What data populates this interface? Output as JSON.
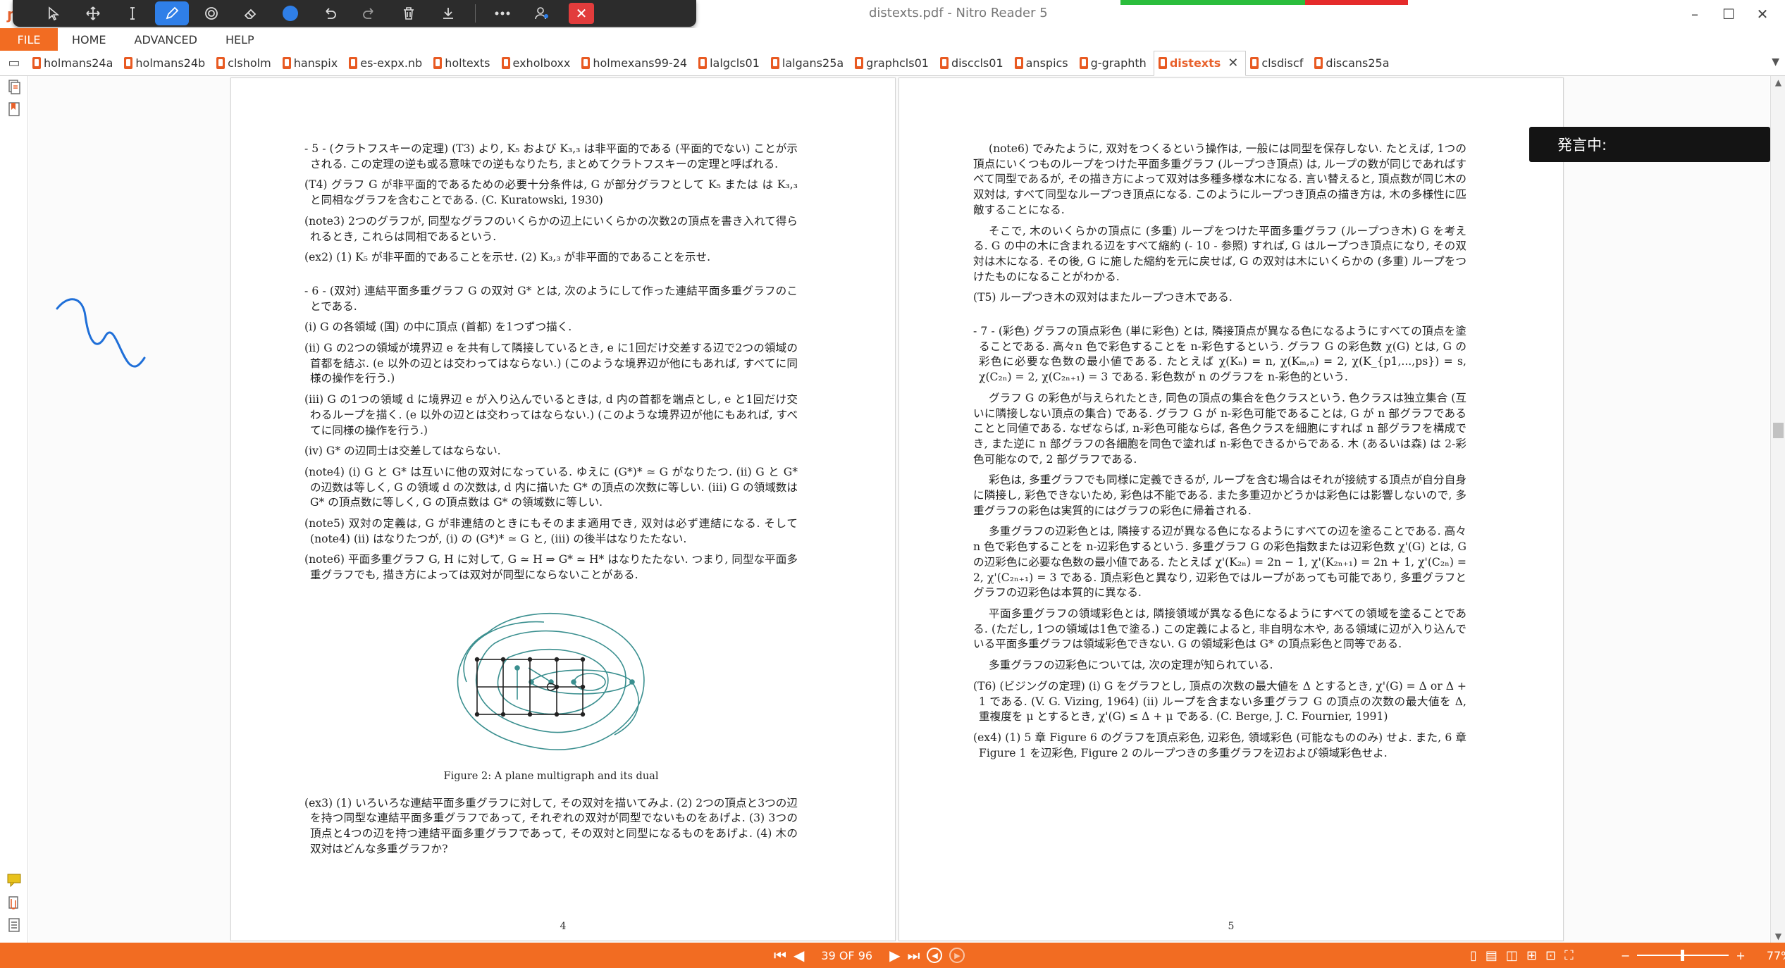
{
  "app": {
    "title": "distexts.pdf - Nitro Reader 5"
  },
  "window": {
    "minimize": "–",
    "maximize": "☐",
    "close": "✕"
  },
  "toolbar": {
    "tools": [
      "select-arrow-icon",
      "pan-icon",
      "text-cursor-icon",
      "pen-icon",
      "stamp-icon",
      "eraser-icon",
      "color-icon",
      "undo-icon",
      "redo-icon",
      "delete-icon",
      "download-icon",
      "more-icon",
      "share-icon",
      "close-icon"
    ],
    "active_tool": "pen-icon",
    "close_label": "✕"
  },
  "menu": {
    "file": "FILE",
    "items": [
      "HOME",
      "ADVANCED",
      "HELP"
    ]
  },
  "tabs": [
    {
      "label": "holmans24a"
    },
    {
      "label": "holmans24b"
    },
    {
      "label": "clsholm"
    },
    {
      "label": "hanspix"
    },
    {
      "label": "es-expx.nb"
    },
    {
      "label": "holtexts"
    },
    {
      "label": "exholboxx"
    },
    {
      "label": "holmexans99-24"
    },
    {
      "label": "lalgcls01"
    },
    {
      "label": "lalgans25a"
    },
    {
      "label": "graphcls01"
    },
    {
      "label": "disccls01"
    },
    {
      "label": "anspics"
    },
    {
      "label": "g-graphth"
    },
    {
      "label": "distexts",
      "active": true
    },
    {
      "label": "clsdiscf"
    },
    {
      "label": "discans25a"
    }
  ],
  "tab_close": "✕",
  "overlay": {
    "speaking_label": "発言中:"
  },
  "pages": {
    "left": {
      "number": "4",
      "paragraphs": [
        "- 5 - (クラトフスキーの定理) (T3) より, K₅ および K₃,₃ は非平面的である (平面的でない) ことが示される. この定理の逆も或る意味での逆もなりたち, まとめてクラトフスキーの定理と呼ばれる.",
        "(T4) グラフ G が非平面的であるための必要十分条件は, G が部分グラフとして K₅ または は K₃,₃ と同相なグラフを含むことである. (C. Kuratowski, 1930)",
        "(note3) 2つのグラフが, 同型なグラフのいくらかの辺上にいくらかの次数2の頂点を書き入れて得られるとき, これらは同相であるという.",
        "(ex2) (1) K₅ が非平面的であることを示せ. (2) K₃,₃ が非平面的であることを示せ.",
        "- 6 - (双対) 連結平面多重グラフ G の双対 G* とは, 次のようにして作った連結平面多重グラフのことである.",
        "(i) G の各領域 (国) の中に頂点 (首都) を1つずつ描く.",
        "(ii) G の2つの領域が境界辺 e を共有して隣接しているとき, e に1回だけ交差する辺で2つの領域の首都を結ぶ. (e 以外の辺とは交わってはならない.) (このような境界辺が他にもあれば, すべてに同様の操作を行う.)",
        "(iii) G の1つの領域 d に境界辺 e が入り込んでいるときは, d 内の首都を端点とし, e と1回だけ交わるループを描く. (e 以外の辺とは交わってはならない.) (このような境界辺が他にもあれば, すべてに同様の操作を行う.)",
        "(iv) G* の辺同士は交差してはならない.",
        "(note4) (i) G と G* は互いに他の双対になっている. ゆえに (G*)* ≃ G がなりたつ. (ii) G と G* の辺数は等しく, G の領域 d の次数は, d 内に描いた G* の頂点の次数に等しい. (iii) G の領域数は G* の頂点数に等しく, G の頂点数は G* の領域数に等しい.",
        "(note5) 双対の定義は, G が非連結のときにもそのまま適用でき, 双対は必ず連結になる. そして (note4) (ii) はなりたつが, (i) の (G*)* ≃ G と, (iii) の後半はなりたたない.",
        "(note6) 平面多重グラフ G, H に対して, G ≃ H ⇒ G* ≃ H* はなりたたない. つまり, 同型な平面多重グラフでも, 描き方によっては双対が同型にならないことがある."
      ],
      "figure_caption": "Figure 2: A plane multigraph and its dual",
      "after_figure": "(ex3) (1) いろいろな連結平面多重グラフに対して, その双対を描いてみよ. (2) 2つの頂点と3つの辺を持つ同型な連結平面多重グラフであって, それぞれの双対が同型でないものをあげよ. (3) 3つの頂点と4つの辺を持つ連結平面多重グラフであって, その双対と同型になるものをあげよ. (4) 木の双対はどんな多重グラフか?"
    },
    "right": {
      "number": "5",
      "paragraphs": [
        "(note6) でみたように, 双対をつくるという操作は, 一般には同型を保存しない. たとえば, 1つの頂点にいくつものループをつけた平面多重グラフ (ループつき頂点) は, ループの数が同じであればすべて同型であるが, その描き方によって双対は多種多様な木になる. 言い替えると, 頂点数が同じ木の双対は, すべて同型なループつき頂点になる. このようにループつき頂点の描き方は, 木の多様性に匹敵することになる.",
        "そこで, 木のいくらかの頂点に (多重) ループをつけた平面多重グラフ (ループつき木) G を考える. G の中の木に含まれる辺をすべて縮約 (- 10 - 参照) すれば, G はループつき頂点になり, その双対は木になる. その後, G に施した縮約を元に戻せば, G の双対は木にいくらかの (多重) ループをつけたものになることがわかる.",
        "(T5) ループつき木の双対はまたループつき木である.",
        "- 7 - (彩色) グラフの頂点彩色 (単に彩色) とは, 隣接頂点が異なる色になるようにすべての頂点を塗ることである. 高々n 色で彩色することを n-彩色するという. グラフ G の彩色数 χ(G) とは, G の彩色に必要な色数の最小値である. たとえば χ(Kₙ) = n, χ(Kₘ,ₙ) = 2, χ(K_{p1,...,ps}) = s, χ(C₂ₙ) = 2, χ(C₂ₙ₊₁) = 3 である. 彩色数が n のグラフを n-彩色的という.",
        "グラフ G の彩色が与えられたとき, 同色の頂点の集合を色クラスという. 色クラスは独立集合 (互いに隣接しない頂点の集合) である. グラフ G が n-彩色可能であることは, G が n 部グラフであることと同値である. なぜならば, n-彩色可能ならば, 各色クラスを細胞にすれば n 部グラフを構成でき, また逆に n 部グラフの各細胞を同色で塗れば n-彩色できるからである. 木 (あるいは森) は 2-彩色可能なので, 2 部グラフである.",
        "彩色は, 多重グラフでも同様に定義できるが, ループを含む場合はそれが接続する頂点が自分自身に隣接し, 彩色できないため, 彩色は不能である. また多重辺かどうかは彩色には影響しないので, 多重グラフの彩色は実質的にはグラフの彩色に帰着される.",
        "多重グラフの辺彩色とは, 隣接する辺が異なる色になるようにすべての辺を塗ることである. 高々n 色で彩色することを n-辺彩色するという. 多重グラフ G の彩色指数または辺彩色数 χ'(G) とは, G の辺彩色に必要な色数の最小値である. たとえば χ'(K₂ₙ) = 2n − 1, χ'(K₂ₙ₊₁) = 2n + 1, χ'(C₂ₙ) = 2, χ'(C₂ₙ₊₁) = 3 である. 頂点彩色と異なり, 辺彩色ではループがあっても可能であり, 多重グラフとグラフの辺彩色は本質的に異なる.",
        "平面多重グラフの領域彩色とは, 隣接領域が異なる色になるようにすべての領域を塗ることである. (ただし, 1つの領域は1色で塗る.) この定義によると, 非自明な木や, ある領域に辺が入り込んでいる平面多重グラフは領域彩色できない. G の領域彩色は G* の頂点彩色と同等である.",
        "多重グラフの辺彩色については, 次の定理が知られている.",
        "(T6) (ビジングの定理) (i) G をグラフとし, 頂点の次数の最大値を Δ とするとき, χ'(G) = Δ or Δ + 1 である. (V. G. Vizing, 1964) (ii) ループを含まない多重グラフ G の頂点の次数の最大値を Δ, 重複度を μ とするとき, χ'(G) ≤ Δ + μ である. (C. Berge, J. C. Fournier, 1991)",
        "(ex4) (1) 5 章 Figure 6 のグラフを頂点彩色, 辺彩色, 領域彩色 (可能なもののみ) せよ. また, 6 章 Figure 1 を辺彩色, Figure 2 のループつきの多重グラフを辺および領域彩色せよ."
      ]
    }
  },
  "status": {
    "page_indicator": "39 OF 96",
    "zoom": "77%",
    "zoom_out": "−",
    "zoom_in": "+"
  },
  "colors": {
    "accent": "#f26c22",
    "toolbar": "#2c2c2c",
    "active_tool": "#2f7fe8",
    "annotation_ink": "#1f6fd8",
    "figure_teal": "#3a8f8f"
  }
}
